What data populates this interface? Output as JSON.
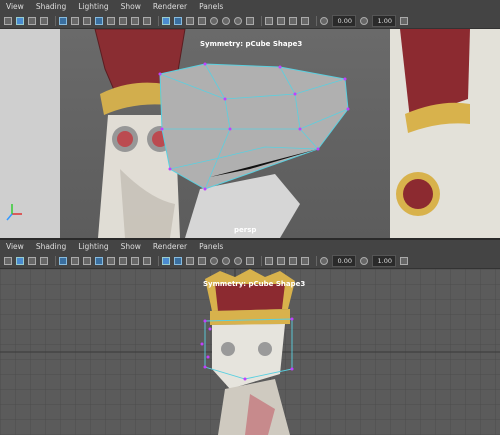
{
  "menus": [
    "View",
    "Shading",
    "Lighting",
    "Show",
    "Renderer",
    "Panels"
  ],
  "top_view": {
    "symmetry_label": "Symmetry: pCube Shape3",
    "camera_label": "persp",
    "value_a": "0.00",
    "value_b": "1.00"
  },
  "bottom_view": {
    "symmetry_label": "Symmetry: pCube Shape3",
    "value_a": "0.00",
    "value_b": "1.00"
  },
  "colors": {
    "wire": "#5ad0e0",
    "vertex": "#c040ff",
    "crown_gold": "#d8b24c",
    "crown_red": "#8c2a30"
  }
}
